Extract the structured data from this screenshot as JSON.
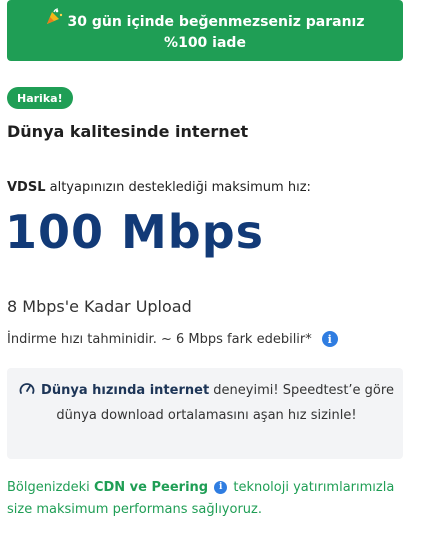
{
  "banner": {
    "icon": "party-popper-icon",
    "text": "30 gün içinde beğenmezseniz paranız %100 iade"
  },
  "badge": "Harika!",
  "title": "Dünya kalitesinde internet",
  "desc": {
    "bold": "VDSL",
    "rest": " altyapınızın desteklediği maksimum hız:"
  },
  "speed": "100 Mbps",
  "upload": "8 Mbps'e Kadar Upload",
  "note": "İndirme hızı tahminidir. ~ 6 Mbps fark edebilir*",
  "box": {
    "icon": "speedometer-icon",
    "bold": "Dünya hızında internet",
    "rest": " deneyimi! Speedtest’e göre dünya download ortalamasını aşan hız sizinle!"
  },
  "footer": {
    "prefix": "Bölgenizdeki ",
    "bold": "CDN ve Peering",
    "suffix": " teknoloji yatırımlarımızla size maksimum performans sağlıyoruz."
  },
  "colors": {
    "green": "#1f9e55",
    "navy": "#123a77",
    "info_blue": "#2f7de1"
  }
}
